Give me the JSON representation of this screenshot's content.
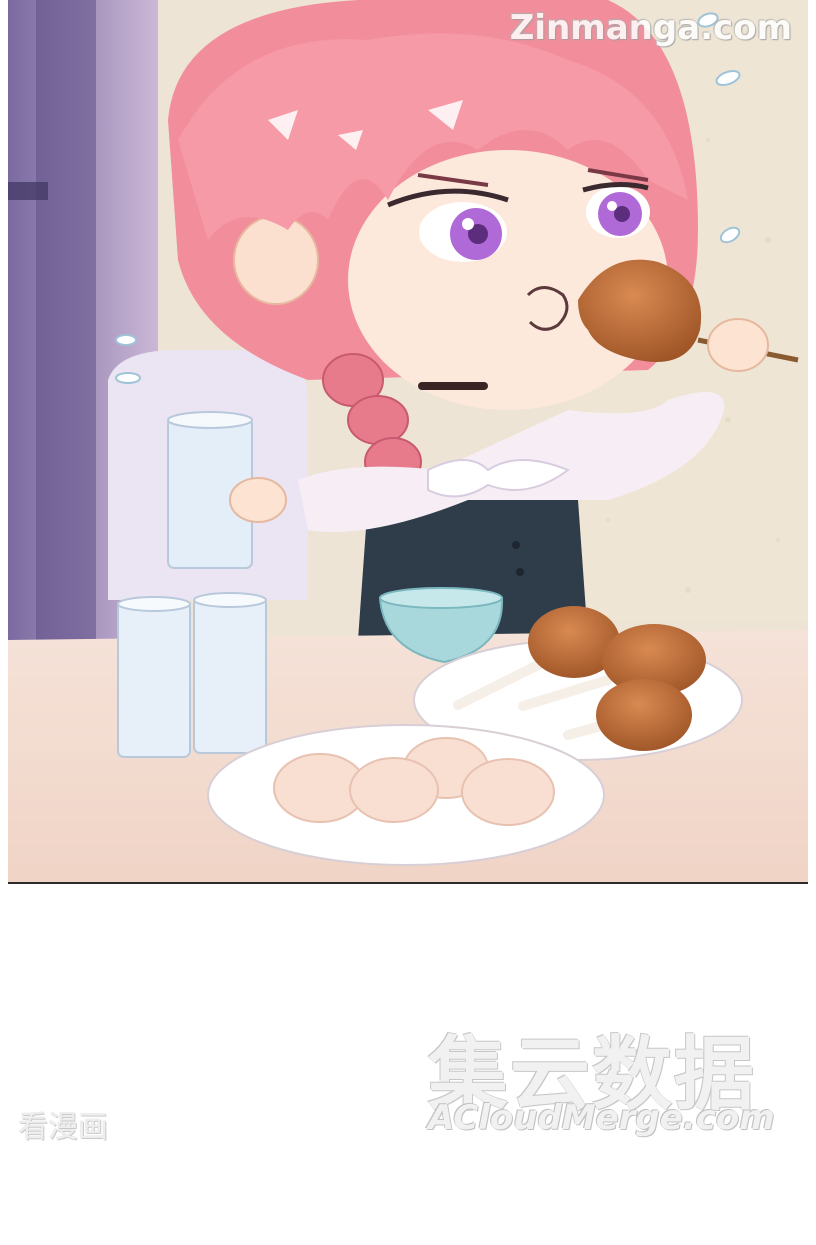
{
  "watermarks": {
    "top_right": "Zinmanga.com",
    "bottom_cn": "集云数据",
    "bottom_en": "ACloudMerge.com",
    "bottom_left": "看漫画"
  },
  "illustration": {
    "colors": {
      "hair": "#f08a98",
      "eyes": "#b06ad8",
      "dress": "#2f3d4a",
      "table": "#f3dcd0",
      "wall": "#eae0d2",
      "chicken": "#c2703e",
      "cup": "#e4eef8",
      "bowl": "#a9d8dc"
    }
  }
}
